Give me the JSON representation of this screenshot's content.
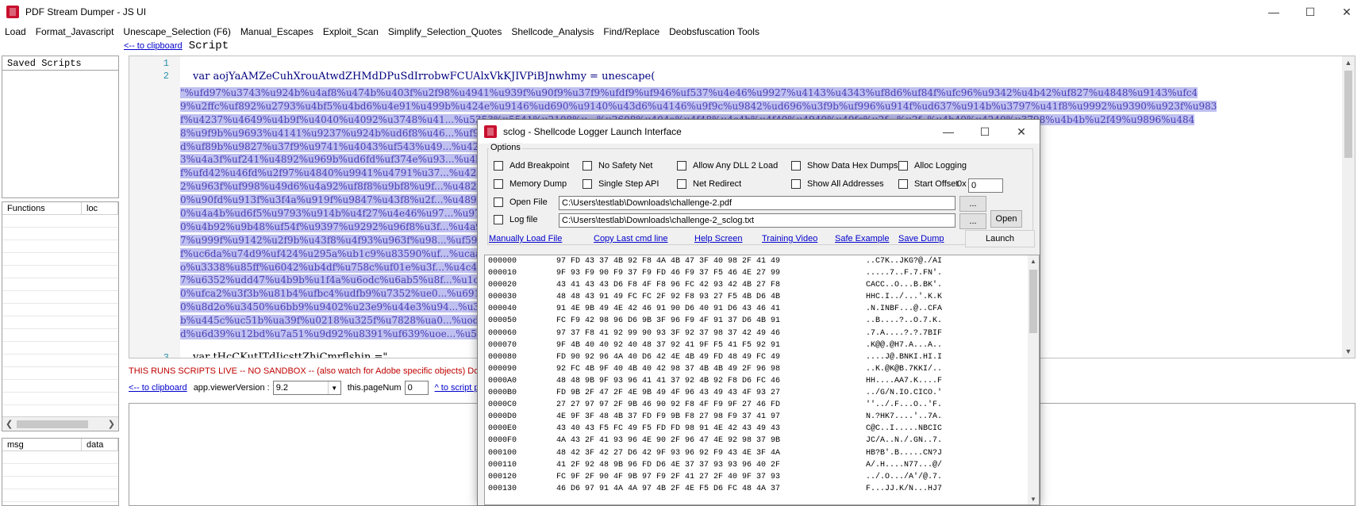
{
  "window": {
    "title": "PDF Stream Dumper - JS UI"
  },
  "menu": [
    "Load",
    "Format_Javascript",
    "Unescape_Selection (F6)",
    "Manual_Escapes",
    "Exploit_Scan",
    "Simplify_Selection_Quotes",
    "Shellcode_Analysis",
    "Find/Replace",
    "Deobsfuscation Tools"
  ],
  "left": {
    "saved_scripts_header": "Saved Scripts",
    "functions_col": "Functions",
    "loc_col": "loc",
    "msg_col": "msg",
    "data_col": "data"
  },
  "editor": {
    "to_clipboard": "<-- to clipboard",
    "script_label": "Script",
    "line_numbers": [
      "1",
      "2",
      "3"
    ],
    "line2_code": "var aojYaAMZeCuhXrouAtwdZHMdDPuSdIrrobwFCUAlxVkKJIVPiBJnwhmy = unescape(",
    "line3_code": "var tHcCKutJTdIjcsttZhiCmrflshin =\"",
    "selected_lines": [
      "\"%ufd97%u3743%u924b%u4af8%u474b%u403f%u2f98%u4941%u939f%u90f9%u37f9%ufdf9%uf946%uf537%u4e46%u9927%u4143%u4343%uf8d6%uf84f%ufc96%u9342%u4b42%uf827%u4848%u9143%ufc4",
      "9%u2ffc%uf892%u2793%u4bf5%u4bd6%u4e91%u499b%u424e%u9146%ud690%u9140%u43d6%u4146%u9f9c%u9842%ud696%u3f9b%uf996%u914f%ud637%u914b%u3797%u41f8%u9992%u9390%u923f%u983",
      "f%u4237%u4649%u4b9f%u4040%u4092%u3748%u41...%u5353%u5541%u2108%u...%u2608%u404a%u4f48%u4c4b%u4f40%u4940%u40fc%u2f...%u2f..%u4b40%u4240%u3798%u4b4b%u2f49%u9896%u484",
      "8%u9f9b%u9693%u4141%u9237%u924b%ud6f8%u46...%uf94f%u279f%ufd46%u9f4e%u483f%u374b%u9f",
      "d%uf89b%u9827%u37f9%u9741%u4043%uf543%u49...%u4248%u423f%ud627%u9f42%u9693%uf992%u4e4",
      "3%u4a3f%uf241%u4892%u969b%ud6fd%uf374e%u93...%u4b97%u4e2f%ud6f5%u48fc%u374a%u484a%ud62",
      "f%ufd42%u46fd%u2f97%u4840%u9941%u4791%u37...%u422f%u414b%u4992%u2727%u4992%ud647%u999",
      "2%u963f%uf998%u49d6%u4a92%uf8f8%u9bf8%u9f...%u4827%u912f%u4f4a%u9f93%u9840%u974a%u429",
      "0%u90fd%u913f%u3f4a%u919f%u9847%u43f8%u2f...%u489b%u97f9%ufd47%u374e%u4841%u962f%u464",
      "0%u4a4b%ud6f5%u9793%u914b%u4f27%u4e46%u97...%u974b%u4149%u9947%ud6f5%u9ff5%u474a%u2f4",
      "0%u4b92%u9b48%uf54f%u9397%u9292%u96f8%u3f...%u4a97%ufc97%u2ffc%uf546%u98d6%u4127%ud69",
      "7%u999f%u9142%u2f9b%u43f8%u4f93%u963f%u98...%uf596%u4a90%u923f%u4193%ubb9f%u2853%u547",
      "f%uc6da%u74d9%uf424%u295a%ub1c9%u83590%uf...%ucaad%u452b%uc2o3%uee5c%u3569%uef52%uf95",
      "o%u3338%u85ff%u6042%ub4df%u758c%uf01e%u3f...%u4c432%ud439%ub2fa%u9e81%u0e77%u1172%u6e7",
      "7%u6352%udd47%u4b9b%u1f4a%u6odc%u6ab5%u8f...%u1c53%u0648%u4477%u270a%u202e%u58fd%u8c3",
      "0%ufca2%u3f3b%u81b4%ufbc4%udfb9%u7352%ue0...%u6919%uboda%uboa6%ub776%uff30%u022e%u974",
      "0%u8d2o%u3450%u6bb9%u9402%u23e9%u44e3%u94...%u3072%u1298%uc87o%ub759%ua27o%u115d%u5a2",
      "b%u445c%uc51b%ua39f%u0218%u325f%u7828%ua0...%uodof%u662d%u0953%uf4d1%ub27o%u06b9%u423",
      "d%u6d39%u12bd%u7a51%u9d92%u8391%uf639%uoe...%u5d09%u2d8f%uc03o%ua7a6%u563e%uedb8\";"
    ]
  },
  "bottom": {
    "warning": "THIS RUNS SCRIPTS LIVE -- NO SANDBOX -- (also watch for Adobe specific objects) Do",
    "to_clipboard": "<-- to clipboard",
    "viewer_label": "app.viewerVersion :",
    "viewer_value": "9.2",
    "pagenum_label": "this.pageNum",
    "pagenum_value": "0",
    "to_script": "^ to script p"
  },
  "dialog": {
    "title": "sclog - Shellcode Logger Launch Interface",
    "options_legend": "Options",
    "options": {
      "add_breakpoint": "Add Breakpoint",
      "no_safety_net": "No Safety Net",
      "allow_any_dll": "Allow Any DLL 2 Load",
      "show_data_hex": "Show Data Hex Dumps",
      "alloc_logging": "Alloc Logging",
      "memory_dump": "Memory Dump",
      "single_step": "Single Step API",
      "net_redirect": "Net Redirect",
      "show_all_addresses": "Show All Addresses",
      "start_offset": "Start Offset",
      "offset_prefix": "0x",
      "offset_value": "0"
    },
    "open_file_label": "Open File",
    "open_file_value": "C:\\Users\\testlab\\Downloads\\challenge-2.pdf",
    "log_file_label": "Log file",
    "log_file_value": "C:\\Users\\testlab\\Downloads\\challenge-2_sclog.txt",
    "browse1": "...",
    "browse2": "...",
    "open_button": "Open",
    "launch_button": "Launch",
    "links": [
      "Manually Load File",
      "Copy Last cmd line",
      "Help Screen",
      "Training Video",
      "Safe Example",
      "Save Dump"
    ],
    "hex_rows": [
      [
        "000000",
        "97 FD 43 37 4B 92 F8 4A 4B 47 3F 40 98 2F 41 49",
        "..C7K..JKG?@./AI"
      ],
      [
        "000010",
        "9F 93 F9 90 F9 37 F9 FD 46 F9 37 F5 46 4E 27 99",
        ".....7..F.7.FN'."
      ],
      [
        "000020",
        "43 41 43 43 D6 F8 4F F8 96 FC 42 93 42 4B 27 F8",
        "CACC..O...B.BK'."
      ],
      [
        "000030",
        "48 48 43 91 49 FC FC 2F 92 F8 93 27 F5 4B D6 4B",
        "HHC.I../...'.K.K"
      ],
      [
        "000040",
        "91 4E 9B 49 4E 42 46 91 90 D6 40 91 D6 43 46 41",
        ".N.INBF...@..CFA"
      ],
      [
        "000050",
        "FC F9 42 98 96 D6 9B 3F 96 F9 4F 91 37 D6 4B 91",
        "..B....?..O.7.K."
      ],
      [
        "000060",
        "97 37 F8 41 92 99 90 93 3F 92 37 98 37 42 49 46",
        ".7.A....?.?.7BIF"
      ],
      [
        "000070",
        "9F 4B 40 40 92 40 48 37 92 41 9F F5 41 F5 92 91",
        ".K@@.@H7.A...A.."
      ],
      [
        "000080",
        "FD 90 92 96 4A 40 D6 42 4E 4B 49 FD 48 49 FC 49",
        "....J@.BNKI.HI.I"
      ],
      [
        "000090",
        "92 FC 4B 9F 40 4B 40 42 98 37 4B 4B 49 2F 96 98",
        "..K.@K@B.7KKI/.."
      ],
      [
        "0000A0",
        "48 48 9B 9F 93 96 41 41 37 92 4B 92 F8 D6 FC 46",
        "HH....AA7.K....F"
      ],
      [
        "0000B0",
        "FD 9B 2F 47 2F 4E 9B 49 4F 96 43 49 43 4F 93 27",
        "../G/N.IO.CICO.'"
      ],
      [
        "0000C0",
        "27 27 97 97 2F 9B 46 90 92 F8 4F F9 9F 27 46 FD",
        "''../.F...O..'F."
      ],
      [
        "0000D0",
        "4E 9F 3F 48 4B 37 FD F9 9B F8 27 98 F9 37 41 97",
        "N.?HK7....'..7A."
      ],
      [
        "0000E0",
        "43 40 43 F5 FC 49 F5 FD FD 98 91 4E 42 43 49 43",
        "C@C..I.....NBCIC"
      ],
      [
        "0000F0",
        "4A 43 2F 41 93 96 4E 90 2F 96 47 4E 92 98 37 9B",
        "JC/A..N./.GN..7."
      ],
      [
        "000100",
        "48 42 3F 42 27 D6 42 9F 93 96 92 F9 43 4E 3F 4A",
        "HB?B'.B.....CN?J"
      ],
      [
        "000110",
        "41 2F 92 48 9B 96 FD D6 4E 37 37 93 93 96 40 2F",
        "A/.H....N77...@/"
      ],
      [
        "000120",
        "FC 9F 2F 90 4F 9B 97 F9 2F 41 27 2F 40 9F 37 93",
        "../.O.../A'/@.7."
      ],
      [
        "000130",
        "46 D6 97 91 4A 4A 97 4B 2F 4E F5 D6 FC 48 4A 37",
        "F...JJ.K/N...HJ7"
      ]
    ]
  }
}
